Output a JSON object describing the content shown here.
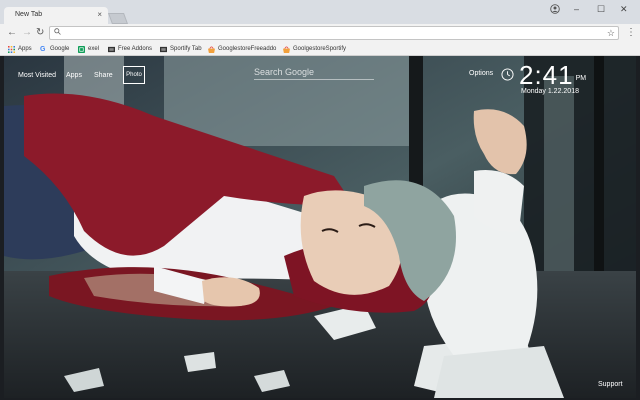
{
  "browser": {
    "tab_title": "New Tab",
    "tab_close": "×",
    "controls": {
      "account": "",
      "minimize": "–",
      "maximize": "☐",
      "close": "✕"
    },
    "nav": {
      "back": "←",
      "forward": "→",
      "reload": "↻"
    },
    "omnibox": {
      "value": "",
      "placeholder": ""
    },
    "menu": "⋮"
  },
  "bookmarks": [
    {
      "label": "Apps",
      "icon": "apps-grid-icon"
    },
    {
      "label": "Google",
      "icon": "google-icon"
    },
    {
      "label": "exel",
      "icon": "sheets-icon"
    },
    {
      "label": "Free Addons",
      "icon": "addon-icon"
    },
    {
      "label": "Sportify Tab",
      "icon": "addon-icon"
    },
    {
      "label": "GooglestoreFreeaddo",
      "icon": "store-icon"
    },
    {
      "label": "GoolgestoreSportify",
      "icon": "store-icon"
    }
  ],
  "newtab": {
    "menu": {
      "most_visited": "Most Visited",
      "apps": "Apps",
      "share": "Share",
      "photo": "Photo"
    },
    "search_placeholder": "Search Google",
    "options": "Options",
    "time": "2:41",
    "ampm": "PM",
    "date": "Monday  1.22.2018",
    "support": "Support"
  },
  "colors": {
    "tabstrip": "#d9dde3",
    "toolbar": "#f2f2f2",
    "jacket": "#8c1a2a",
    "accent": "#ffffff"
  }
}
